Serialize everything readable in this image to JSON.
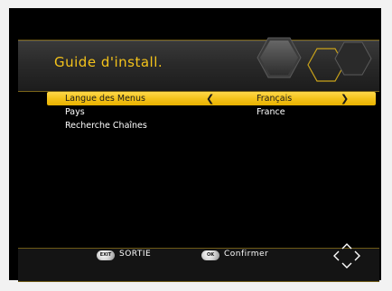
{
  "header": {
    "title": "Guide d'install."
  },
  "menu": {
    "items": [
      {
        "label": "Langue des Menus",
        "value": "Français",
        "left_arrow": "❮",
        "right_arrow": "❯"
      },
      {
        "label": "Pays",
        "value": "France"
      },
      {
        "label": "Recherche Chaînes",
        "value": ""
      }
    ]
  },
  "footer": {
    "exit_key": "EXIT",
    "exit_label": "SORTIE",
    "ok_key": "OK",
    "ok_label": "Confirmer",
    "nav_icon": "directional-pad-icon"
  },
  "colors": {
    "accent": "#f4c31b",
    "background": "#000000",
    "bar": "#2a2a2a",
    "text": "#ffffff"
  }
}
